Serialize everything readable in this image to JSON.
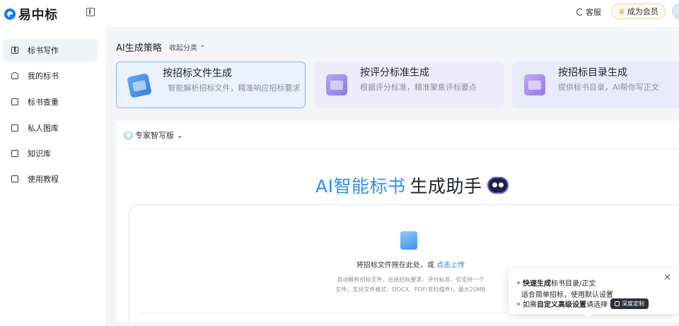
{
  "brand": {
    "logo_text": "易中标"
  },
  "header": {
    "service_label": "客服",
    "vip_label": "成为会员"
  },
  "sidebar": {
    "items": [
      {
        "label": "标书写作",
        "icon": "book-icon",
        "active": true
      },
      {
        "label": "我的标书",
        "icon": "user-icon",
        "active": false
      },
      {
        "label": "标书查重",
        "icon": "check-doc-icon",
        "active": false
      },
      {
        "label": "私人图库",
        "icon": "gallery-icon",
        "active": false
      },
      {
        "label": "知识库",
        "icon": "folder-icon",
        "active": false
      },
      {
        "label": "使用教程",
        "icon": "tutorial-icon",
        "active": false
      }
    ]
  },
  "strategy": {
    "title": "AI生成策略",
    "collapse_label": "收起分类 ⌃",
    "cards": [
      {
        "title": "按招标文件生成",
        "desc": "智能解析招标文件，精准响应招标要求"
      },
      {
        "title": "按评分标准生成",
        "desc": "根据评分标准，精准聚焦评标要点"
      },
      {
        "title": "按招标目录生成",
        "desc": "提供标书目录，AI帮你写正文"
      }
    ]
  },
  "panel": {
    "version_label": "专家智写版 ⌄",
    "hero_blue": "AI智能标书",
    "hero_dark": "生成助手",
    "upload_text": "将招标文件拖在此处，或",
    "upload_link": "点击上传",
    "hint_line1": "自动解析招标文件，总结招标要求、评分标准，仅支持一个",
    "hint_line2": "文件，支持文件格式：DOCX、PDF(非扫描件)，最大20MB"
  },
  "tooltip": {
    "line1_bold": "快速生成",
    "line1_rest": "标书目录/正文",
    "line2": "适合简单招标，使用默认设置",
    "line3_pre": "如需",
    "line3_bold": "自定义高级设置",
    "line3_post": "请选择",
    "button_label": "深度定制",
    "close_label": "×"
  },
  "colors": {
    "accent": "#1677ff",
    "hero_blue": "#2f8cf2",
    "link": "#2f7cf0"
  }
}
